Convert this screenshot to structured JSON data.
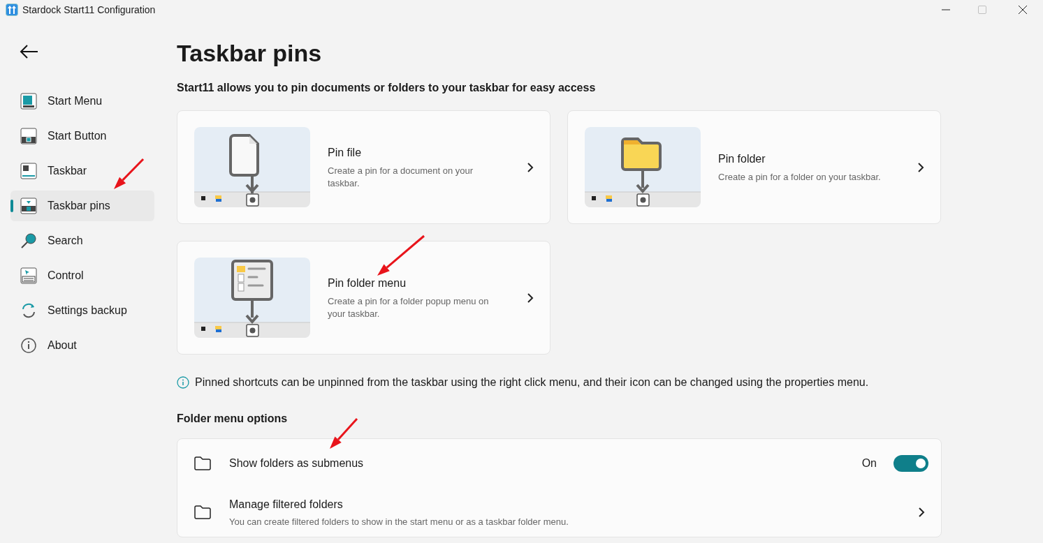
{
  "window": {
    "title": "Stardock Start11 Configuration",
    "maximize_disabled": true
  },
  "sidebar": {
    "items": [
      {
        "label": "Start Menu",
        "kind": "startmenu",
        "selected": false
      },
      {
        "label": "Start Button",
        "kind": "startbutton",
        "selected": false
      },
      {
        "label": "Taskbar",
        "kind": "taskbar",
        "selected": false
      },
      {
        "label": "Taskbar pins",
        "kind": "pins",
        "selected": true
      },
      {
        "label": "Search",
        "kind": "search",
        "selected": false
      },
      {
        "label": "Control",
        "kind": "control",
        "selected": false
      },
      {
        "label": "Settings backup",
        "kind": "backup",
        "selected": false
      },
      {
        "label": "About",
        "kind": "about",
        "selected": false
      }
    ]
  },
  "page": {
    "title": "Taskbar pins",
    "subtitle": "Start11 allows you to pin documents or folders to your taskbar for easy access",
    "cards": [
      {
        "kind": "file",
        "title": "Pin file",
        "description": "Create a pin for a document on your taskbar."
      },
      {
        "kind": "folder",
        "title": "Pin folder",
        "description": "Create a pin for a folder on your taskbar."
      },
      {
        "kind": "menu",
        "title": "Pin folder menu",
        "description": "Create a pin for a folder popup menu on your taskbar."
      }
    ],
    "info": "Pinned shortcuts can be unpinned from the taskbar using the right click menu, and their icon can be changed using the properties menu.",
    "section": "Folder menu options",
    "options": [
      {
        "kind": "toggle",
        "label": "Show folders as submenus",
        "on": true,
        "state_label": "On"
      },
      {
        "kind": "link",
        "label": "Manage filtered folders",
        "description": "You can create filtered folders to show in the start menu or as a taskbar folder menu."
      }
    ]
  }
}
